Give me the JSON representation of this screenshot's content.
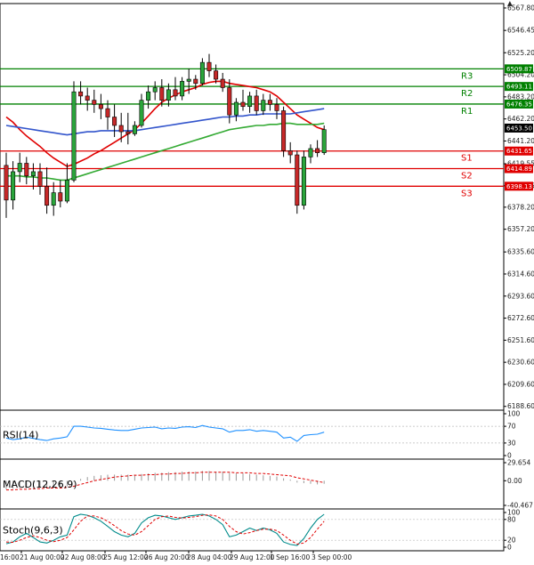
{
  "chart_data": {
    "type": "candlestick",
    "price_axis": {
      "ticks": [
        "6567.80",
        "6546.45",
        "6525.20",
        "6504.20",
        "6483.20",
        "6462.20",
        "6441.20",
        "6419.55",
        "6398.55",
        "6378.20",
        "6357.20",
        "6335.60",
        "6314.60",
        "6293.60",
        "6272.60",
        "6251.60",
        "6230.60",
        "6209.60",
        "6188.60"
      ],
      "range": [
        6185,
        6572
      ],
      "current": {
        "value": 6453.5,
        "label": "6453.50"
      }
    },
    "time_axis": {
      "ticks": [
        "16:00",
        "21 Aug 00:00",
        "22 Aug 08:00",
        "25 Aug 12:00",
        "26 Aug 20:00",
        "28 Aug 04:00",
        "29 Aug 12:00",
        "1 Sep 16:00",
        "3 Sep 00:00"
      ]
    },
    "levels": [
      {
        "name": "R3",
        "value": 6509.87,
        "label": "6509.87",
        "color": "#008000"
      },
      {
        "name": "R2",
        "value": 6493.11,
        "label": "6493.11",
        "color": "#008000"
      },
      {
        "name": "R1",
        "value": 6476.35,
        "label": "6476.35",
        "color": "#008000"
      },
      {
        "name": "S1",
        "value": 6431.65,
        "label": "6431.65",
        "color": "#e00000"
      },
      {
        "name": "S2",
        "value": 6414.89,
        "label": "6414.89",
        "color": "#e00000"
      },
      {
        "name": "S3",
        "value": 6398.13,
        "label": "6398.13",
        "color": "#e00000"
      }
    ],
    "candles": [
      [
        6418,
        6430,
        6368,
        6385
      ],
      [
        6385,
        6422,
        6376,
        6412
      ],
      [
        6412,
        6430,
        6402,
        6420
      ],
      [
        6420,
        6426,
        6400,
        6408
      ],
      [
        6408,
        6420,
        6395,
        6412
      ],
      [
        6412,
        6420,
        6390,
        6398
      ],
      [
        6398,
        6416,
        6372,
        6380
      ],
      [
        6380,
        6402,
        6370,
        6392
      ],
      [
        6392,
        6404,
        6378,
        6384
      ],
      [
        6384,
        6420,
        6382,
        6404
      ],
      [
        6404,
        6498,
        6402,
        6488
      ],
      [
        6488,
        6498,
        6476,
        6484
      ],
      [
        6484,
        6492,
        6470,
        6480
      ],
      [
        6480,
        6490,
        6468,
        6476
      ],
      [
        6476,
        6486,
        6462,
        6472
      ],
      [
        6472,
        6480,
        6452,
        6464
      ],
      [
        6464,
        6476,
        6445,
        6456
      ],
      [
        6456,
        6468,
        6440,
        6450
      ],
      [
        6450,
        6468,
        6438,
        6448
      ],
      [
        6448,
        6460,
        6446,
        6456
      ],
      [
        6456,
        6486,
        6454,
        6480
      ],
      [
        6480,
        6494,
        6472,
        6488
      ],
      [
        6488,
        6498,
        6480,
        6492
      ],
      [
        6492,
        6500,
        6474,
        6480
      ],
      [
        6480,
        6496,
        6474,
        6490
      ],
      [
        6490,
        6502,
        6480,
        6484
      ],
      [
        6484,
        6502,
        6480,
        6498
      ],
      [
        6498,
        6510,
        6486,
        6500
      ],
      [
        6500,
        6504,
        6490,
        6496
      ],
      [
        6496,
        6520,
        6494,
        6516
      ],
      [
        6516,
        6524,
        6502,
        6508
      ],
      [
        6508,
        6514,
        6496,
        6500
      ],
      [
        6500,
        6506,
        6488,
        6492
      ],
      [
        6492,
        6500,
        6458,
        6466
      ],
      [
        6466,
        6482,
        6460,
        6478
      ],
      [
        6478,
        6490,
        6470,
        6474
      ],
      [
        6474,
        6488,
        6468,
        6484
      ],
      [
        6484,
        6490,
        6466,
        6470
      ],
      [
        6470,
        6486,
        6466,
        6480
      ],
      [
        6480,
        6486,
        6470,
        6476
      ],
      [
        6476,
        6482,
        6462,
        6470
      ],
      [
        6470,
        6474,
        6426,
        6432
      ],
      [
        6432,
        6440,
        6420,
        6428
      ],
      [
        6428,
        6432,
        6372,
        6380
      ],
      [
        6380,
        6432,
        6376,
        6426
      ],
      [
        6426,
        6438,
        6420,
        6434
      ],
      [
        6434,
        6442,
        6426,
        6430
      ],
      [
        6430,
        6456,
        6428,
        6452
      ]
    ],
    "moving_averages": [
      {
        "color": "#e00000",
        "values": [
          6464,
          6459,
          6452,
          6446,
          6441,
          6436,
          6430,
          6425,
          6421,
          6417,
          6419,
          6422,
          6425,
          6429,
          6432,
          6436,
          6440,
          6444,
          6448,
          6452,
          6458,
          6465,
          6472,
          6478,
          6482,
          6485,
          6488,
          6490,
          6492,
          6495,
          6497,
          6498,
          6498,
          6496,
          6495,
          6494,
          6493,
          6492,
          6490,
          6488,
          6484,
          6478,
          6472,
          6466,
          6462,
          6458,
          6454,
          6452
        ]
      },
      {
        "color": "#3355cc",
        "values": [
          6456,
          6455,
          6454,
          6453,
          6452,
          6451,
          6450,
          6449,
          6448,
          6447,
          6448,
          6449,
          6450,
          6450,
          6451,
          6451,
          6451,
          6451,
          6451,
          6451,
          6452,
          6453,
          6454,
          6455,
          6456,
          6457,
          6458,
          6459,
          6460,
          6461,
          6462,
          6463,
          6464,
          6464,
          6465,
          6465,
          6466,
          6466,
          6467,
          6467,
          6467,
          6467,
          6467,
          6468,
          6469,
          6470,
          6471,
          6472
        ]
      },
      {
        "color": "#33aa33",
        "values": [
          6408,
          6408,
          6408,
          6407,
          6407,
          6406,
          6406,
          6405,
          6404,
          6404,
          6406,
          6408,
          6410,
          6412,
          6414,
          6416,
          6418,
          6420,
          6422,
          6424,
          6426,
          6428,
          6430,
          6432,
          6434,
          6436,
          6438,
          6440,
          6442,
          6444,
          6446,
          6448,
          6450,
          6452,
          6453,
          6454,
          6455,
          6456,
          6456,
          6457,
          6457,
          6458,
          6458,
          6457,
          6457,
          6457,
          6457,
          6458
        ]
      }
    ],
    "indicators": [
      {
        "title": "RSI(14)",
        "ticks": [
          "100",
          "70",
          "30",
          "0"
        ],
        "range": [
          0,
          100
        ],
        "guides": [
          70,
          30
        ],
        "line_color": "#1e90ff",
        "values": [
          42,
          38,
          40,
          44,
          41,
          38,
          36,
          40,
          42,
          45,
          70,
          70,
          68,
          66,
          65,
          63,
          61,
          60,
          60,
          63,
          66,
          67,
          68,
          64,
          66,
          65,
          68,
          69,
          67,
          72,
          68,
          66,
          64,
          56,
          60,
          60,
          62,
          58,
          60,
          58,
          56,
          42,
          44,
          34,
          48,
          50,
          51,
          56
        ]
      },
      {
        "title": "MACD(12,26,9)",
        "ticks": [
          "29.654",
          "0.00",
          "-40.467"
        ],
        "range": [
          -40.467,
          29.654
        ],
        "zero": 0,
        "hist_color": "#999999",
        "signal_color": "#e00000",
        "hist": [
          -14,
          -13,
          -12,
          -12,
          -11,
          -11,
          -11,
          -10,
          -10,
          -9,
          -2,
          3,
          6,
          8,
          9,
          10,
          10,
          10,
          10,
          10,
          11,
          12,
          13,
          13,
          14,
          14,
          15,
          15,
          15,
          16,
          16,
          15,
          15,
          13,
          12,
          12,
          11,
          10,
          9,
          8,
          7,
          4,
          2,
          -3,
          -4,
          -5,
          -6,
          -5
        ],
        "signal": [
          -15,
          -15,
          -14,
          -14,
          -13,
          -13,
          -12,
          -12,
          -12,
          -11,
          -9,
          -6,
          -3,
          0,
          2,
          4,
          6,
          7,
          8,
          9,
          9,
          10,
          10,
          11,
          11,
          12,
          12,
          13,
          13,
          14,
          14,
          14,
          14,
          14,
          13,
          13,
          13,
          12,
          12,
          11,
          10,
          9,
          8,
          5,
          3,
          1,
          -1,
          -3
        ]
      },
      {
        "title": "Stoch(9,6,3)",
        "ticks": [
          "100",
          "80",
          "20",
          "0"
        ],
        "range": [
          0,
          100
        ],
        "guides": [
          80,
          20
        ],
        "main_color": "#008b8b",
        "signal_color": "#e00000",
        "main": [
          10,
          15,
          30,
          40,
          28,
          15,
          12,
          20,
          30,
          35,
          88,
          95,
          92,
          85,
          75,
          60,
          45,
          35,
          30,
          40,
          70,
          85,
          92,
          90,
          85,
          80,
          85,
          90,
          92,
          95,
          90,
          80,
          65,
          30,
          35,
          45,
          55,
          48,
          55,
          50,
          40,
          15,
          8,
          5,
          25,
          55,
          80,
          95
        ],
        "signal": [
          15,
          14,
          20,
          28,
          33,
          28,
          20,
          16,
          20,
          28,
          50,
          75,
          90,
          90,
          85,
          75,
          62,
          48,
          38,
          35,
          45,
          62,
          80,
          88,
          90,
          86,
          84,
          86,
          88,
          92,
          93,
          90,
          80,
          60,
          45,
          38,
          42,
          48,
          52,
          52,
          48,
          35,
          20,
          9,
          12,
          28,
          52,
          75
        ]
      }
    ]
  }
}
